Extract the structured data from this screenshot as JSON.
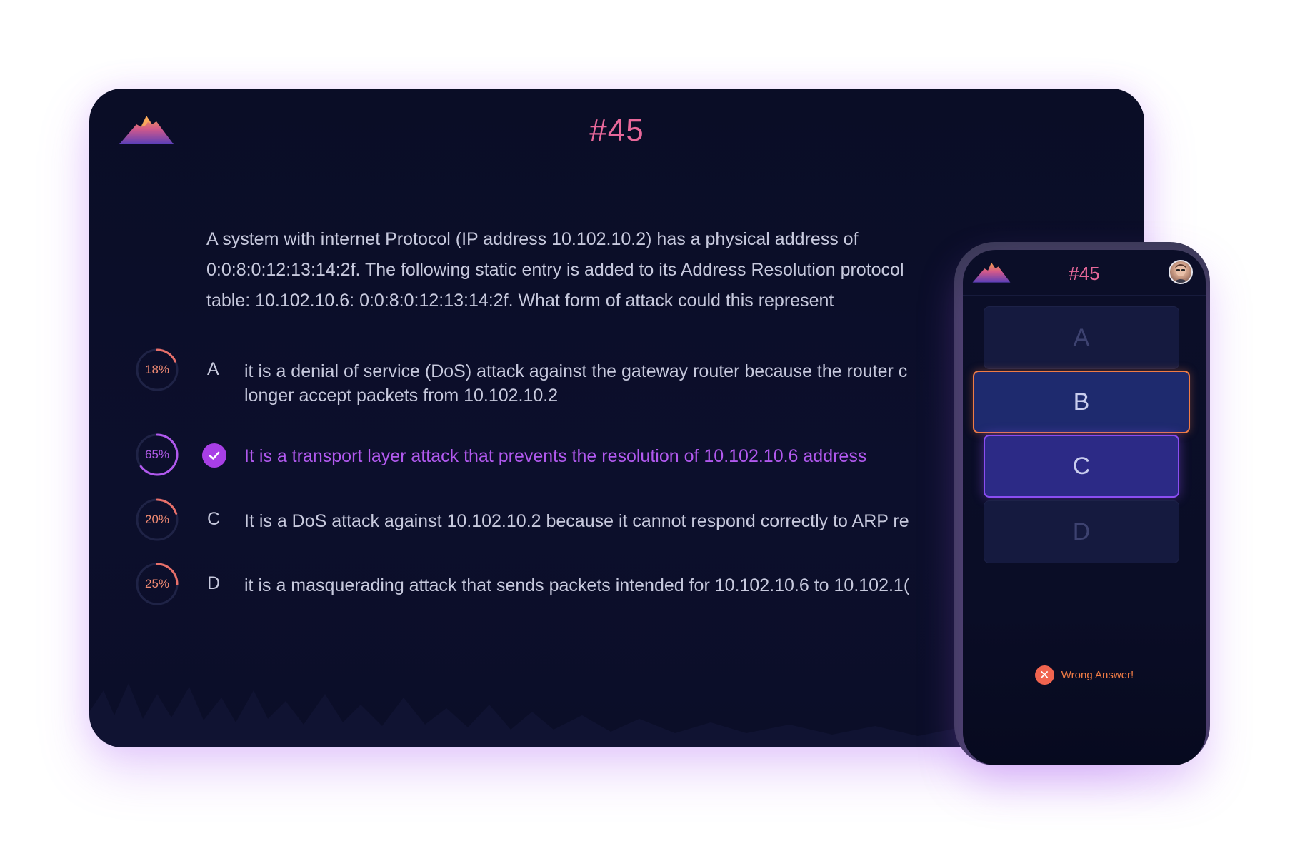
{
  "desktop": {
    "logo_icon": "mountain-logo-icon",
    "question_number": "#45",
    "question_lines": [
      "A system with internet Protocol (IP address 10.102.10.2) has a physical address of",
      "0:0:8:0:12:13:14:2f. The following static entry is added to its Address Resolution protocol",
      "table: 10.102.10.6: 0:0:8:0:12:13:14:2f. What form of attack could this represent"
    ],
    "options": [
      {
        "percent": "18%",
        "percent_value": 18,
        "letter": "A",
        "line1": "it is a denial of service (DoS) attack against the gateway router because the router c",
        "line2": "longer accept packets from 10.102.10.2",
        "correct": false
      },
      {
        "percent": "65%",
        "percent_value": 65,
        "letter": "B",
        "line1": "It is a transport layer attack that prevents the resolution of 10.102.10.6 address",
        "line2": "",
        "correct": true
      },
      {
        "percent": "20%",
        "percent_value": 20,
        "letter": "C",
        "line1": "It is a DoS attack against 10.102.10.2 because it cannot respond correctly to ARP re",
        "line2": "",
        "correct": false
      },
      {
        "percent": "25%",
        "percent_value": 25,
        "letter": "D",
        "line1": "it is a masquerading attack that sends packets intended for 10.102.10.6 to 10.102.1(",
        "line2": "",
        "correct": false
      }
    ]
  },
  "mobile": {
    "question_number": "#45",
    "avatar_icon": "user-avatar",
    "buttons": [
      "A",
      "B",
      "C",
      "D"
    ],
    "result_icon": "close-icon",
    "result_text": "Wrong Answer!"
  },
  "colors": {
    "accent_pink": "#e8689a",
    "correct_purple": "#b159ee",
    "wrong_orange": "#f07c45",
    "bg_dark": "#0a0d26"
  }
}
